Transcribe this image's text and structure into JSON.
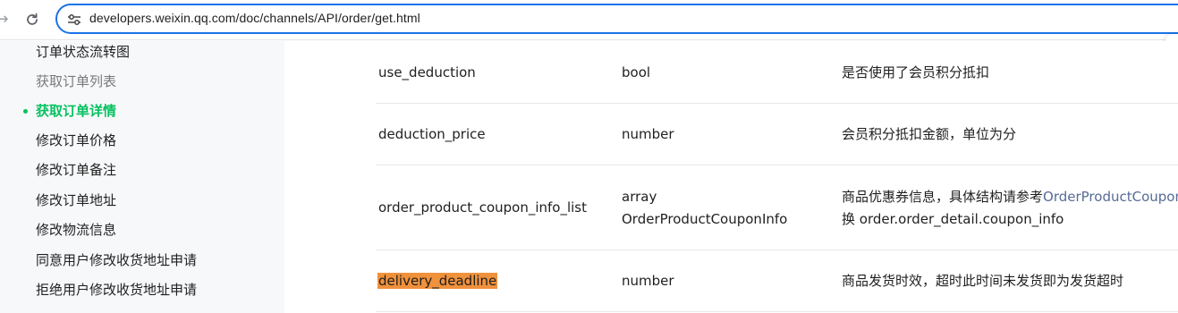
{
  "browser": {
    "url": "developers.weixin.qq.com/doc/channels/API/order/get.html",
    "back_icon": "arrow-right-icon",
    "reload_icon": "reload-icon",
    "site_info_icon": "tune-icon"
  },
  "sidebar": {
    "items": [
      {
        "label": "订单状态流转图",
        "state": "normal"
      },
      {
        "label": "获取订单列表",
        "state": "muted"
      },
      {
        "label": "获取订单详情",
        "state": "active"
      },
      {
        "label": "修改订单价格",
        "state": "normal"
      },
      {
        "label": "修改订单备注",
        "state": "normal"
      },
      {
        "label": "修改订单地址",
        "state": "normal"
      },
      {
        "label": "修改物流信息",
        "state": "normal"
      },
      {
        "label": "同意用户修改收货地址申请",
        "state": "normal"
      },
      {
        "label": "拒绝用户修改收货地址申请",
        "state": "normal"
      }
    ]
  },
  "table": {
    "rows": [
      {
        "name": "use_deduction",
        "type": [
          "bool"
        ],
        "desc": [
          "是否使用了会员积分抵扣"
        ]
      },
      {
        "name": "deduction_price",
        "type": [
          "number"
        ],
        "desc": [
          "会员积分抵扣金额，单位为分"
        ]
      },
      {
        "name": "order_product_coupon_info_list",
        "type": [
          "array",
          "OrderProductCouponInfo"
        ],
        "desc_prefix": "商品优惠券信息，具体结构请参考",
        "desc_link": "OrderProductCoupon",
        "desc_line2": "换 order.order_detail.coupon_info"
      },
      {
        "name": "delivery_deadline",
        "type": [
          "number"
        ],
        "desc": [
          "商品发货时效，超时此时间未发货即为发货超时"
        ],
        "highlighted": true
      }
    ]
  },
  "colors": {
    "accent_green": "#07c160",
    "link": "#576b95",
    "highlight": "#f0913c",
    "omnibox_border": "#1a73e8"
  }
}
